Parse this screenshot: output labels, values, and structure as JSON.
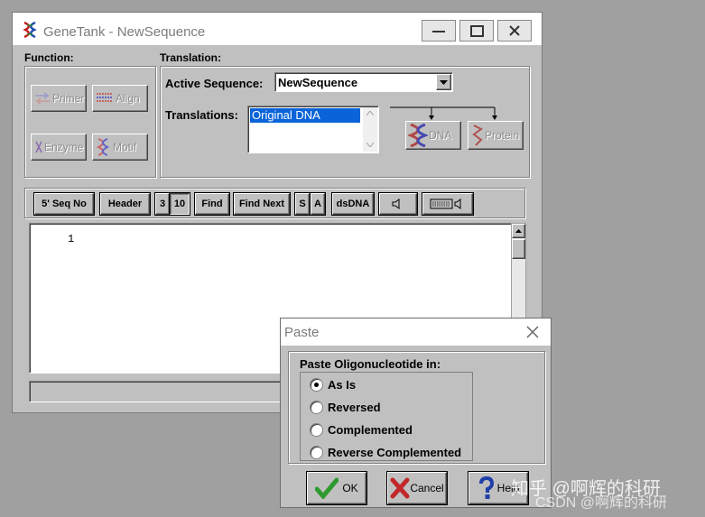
{
  "main_window": {
    "title": "GeneTank - NewSequence",
    "controls": {
      "minimize": "minimize",
      "maximize": "maximize",
      "close": "close"
    }
  },
  "function_panel": {
    "label": "Function:",
    "buttons": {
      "primer": "Primer",
      "align": "Align",
      "enzyme": "Enzyme",
      "motif": "Motif"
    }
  },
  "translation_panel": {
    "label": "Translation:",
    "active_sequence_label": "Active Sequence:",
    "active_sequence_value": "NewSequence",
    "translations_label": "Translations:",
    "translations_items": [
      "Original DNA"
    ],
    "dna_button": "DNA",
    "protein_button": "Protein"
  },
  "toolbar": {
    "seq_no": "5' Seq No",
    "header": "Header",
    "three": "3",
    "ten": "10",
    "find": "Find",
    "find_next": "Find Next",
    "s": "S",
    "a": "A",
    "dsdna": "dsDNA"
  },
  "editor": {
    "line_number": "1"
  },
  "paste_dialog": {
    "title": "Paste",
    "group_label": "Paste Oligonucleotide in:",
    "options": [
      {
        "label": "As Is",
        "selected": true
      },
      {
        "label": "Reversed",
        "selected": false
      },
      {
        "label": "Complemented",
        "selected": false
      },
      {
        "label": "Reverse Complemented",
        "selected": false
      }
    ],
    "ok_label": "OK",
    "cancel_label": "Cancel",
    "help_label": "Help"
  },
  "watermark": {
    "line1": "知乎 @啊辉的科研",
    "line2": "CSDN @啊辉的科研"
  },
  "colors": {
    "selection": "#0a64d8",
    "ok_check": "#2e9a2e",
    "cancel_x": "#c0282a",
    "help_blue": "#1f3fa8"
  }
}
